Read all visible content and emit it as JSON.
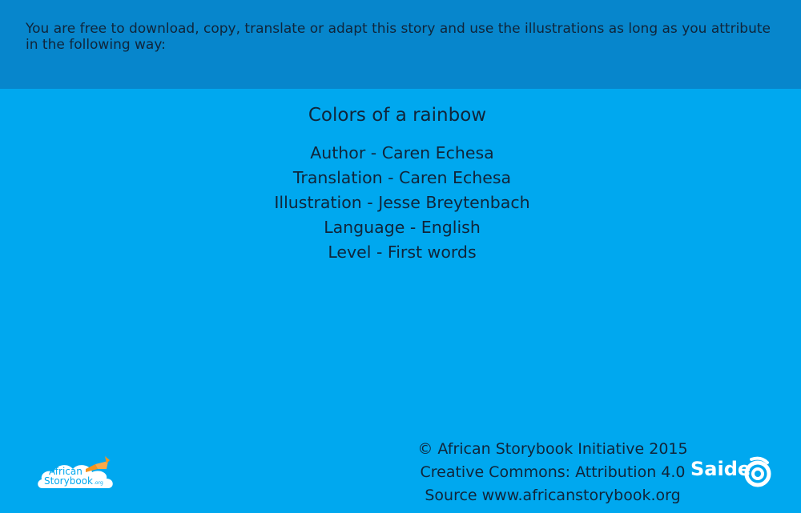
{
  "banner": {
    "text": "You are free to download, copy, translate or adapt this story and use the illustrations as long as you attribute in the following way:"
  },
  "story": {
    "title": "Colors of a rainbow",
    "credits": [
      "Author - Caren Echesa",
      "Translation - Caren Echesa",
      "Illustration - Jesse Breytenbach",
      "Language - English",
      "Level - First words"
    ]
  },
  "footer": {
    "lines": [
      "© African Storybook Initiative 2015",
      "Creative Commons: Attribution 4.0",
      "Source www.africanstorybook.org"
    ]
  },
  "logos": {
    "african_storybook": {
      "line1": "African",
      "line2": "Storybook",
      "suffix": ".org",
      "colors": {
        "cloud": "#ffffff",
        "text": "#00a8ef",
        "book": "#f7941d"
      }
    },
    "saide": {
      "word": "Saide",
      "color": "#ffffff"
    }
  },
  "colors": {
    "background": "#00a8ef",
    "banner": "#0786cc",
    "text": "#10253a"
  }
}
